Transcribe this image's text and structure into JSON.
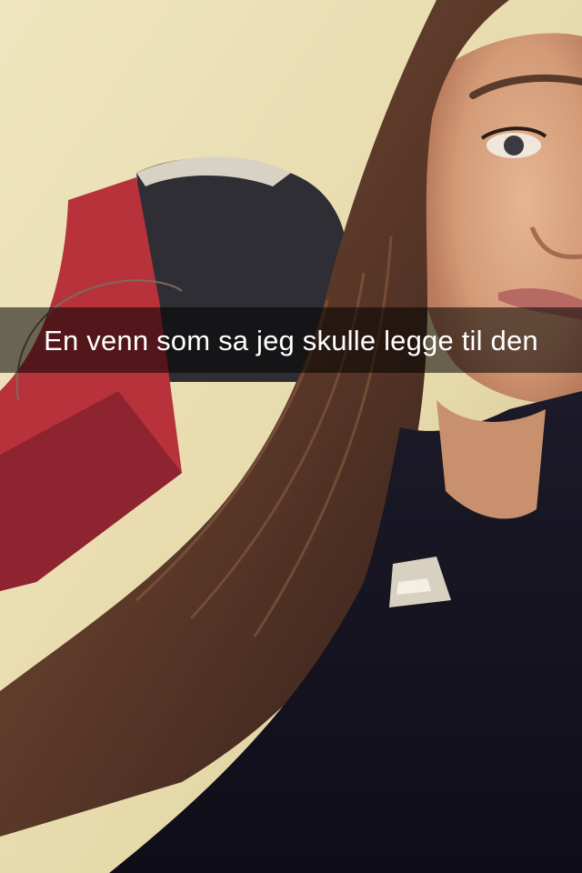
{
  "snap": {
    "caption": "En venn som sa jeg skulle legge til den"
  },
  "colors": {
    "wall": "#eadfb6",
    "wall_shadow": "#cdbf93",
    "hair": "#5a3a28",
    "hair_dark": "#2e1d18",
    "skin": "#d9a27e",
    "sweater": "#141320",
    "pillow_red": "#b8323c",
    "pillow_dark": "#2f2e34",
    "caption_bar": "rgba(0,0,0,0.55)",
    "caption_text": "#ffffff"
  }
}
